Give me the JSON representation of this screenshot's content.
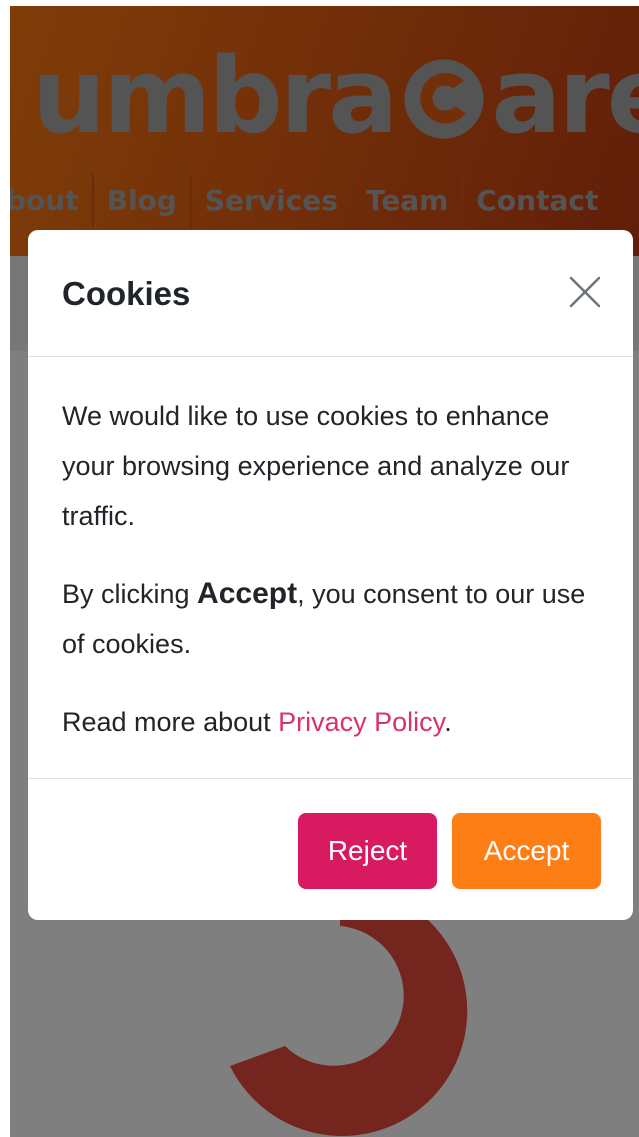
{
  "header": {
    "logo_prefix": "umbra",
    "logo_suffix": "are",
    "nav": [
      {
        "label": "bout"
      },
      {
        "label": "Blog"
      },
      {
        "label": "Services"
      },
      {
        "label": "Team"
      },
      {
        "label": "Contact"
      }
    ]
  },
  "modal": {
    "title": "Cookies",
    "close_icon": "close-x-icon",
    "paragraph1": "We would like to use cookies to enhance your browsing experience and analyze our traffic.",
    "paragraph2_before": "By clicking ",
    "paragraph2_strong": "Accept",
    "paragraph2_after": ", you consent to our use of cookies.",
    "paragraph3_before": "Read more about ",
    "paragraph3_link": "Privacy Policy",
    "paragraph3_after": ".",
    "reject_label": "Reject",
    "accept_label": "Accept"
  },
  "colors": {
    "header_orange": "#ff7a12",
    "logo_gray": "#a8a8a8",
    "reject": "#d81b60",
    "accept": "#fd7e14",
    "link": "#d6336c",
    "backdrop": "rgba(0,0,0,0.5)"
  }
}
